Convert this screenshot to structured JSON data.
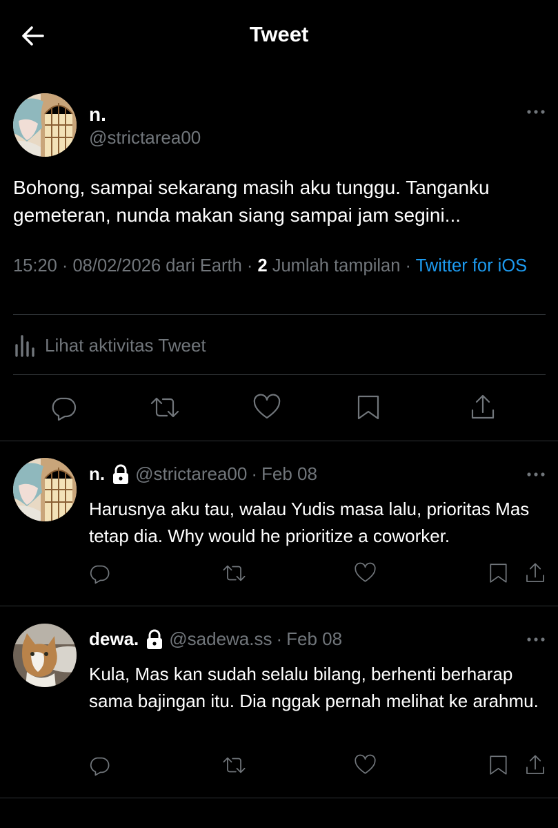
{
  "header": {
    "title": "Tweet"
  },
  "main_tweet": {
    "name": "n.",
    "handle": "@strictarea00",
    "text": "Bohong, sampai sekarang masih aku tunggu. Tanganku gemeteran, nunda makan siang sampai jam segini...",
    "time": "15:20",
    "date": "08/02/2026",
    "location": "dari Earth",
    "views_count": "2",
    "views_label": "Jumlah tampilan",
    "source": "Twitter for iOS",
    "separator": "·",
    "activity_label": "Lihat aktivitas Tweet"
  },
  "replies": [
    {
      "name": "n.",
      "handle": "@strictarea00",
      "date": "Feb 08",
      "text": "Harusnya aku tau, walau Yudis masa lalu, prioritas Mas tetap dia. Why would he prioritize a coworker."
    },
    {
      "name": "dewa.",
      "handle": "@sadewa.ss",
      "date": "Feb 08",
      "text": "Kula, Mas kan sudah selalu bilang, berhenti berharap sama bajingan itu. Dia nggak pernah melihat ke arahmu."
    }
  ],
  "icons": {
    "back": "arrow-left-icon",
    "more": "more-horizontal-icon",
    "reply": "reply-icon",
    "retweet": "retweet-icon",
    "like": "heart-icon",
    "bookmark": "bookmark-icon",
    "share": "share-icon",
    "activity": "bar-chart-icon",
    "lock": "lock-icon"
  },
  "colors": {
    "background": "#000000",
    "text": "#e7e9ea",
    "secondary": "#71767b",
    "link": "#1d9bf0",
    "divider": "#2f3336"
  }
}
